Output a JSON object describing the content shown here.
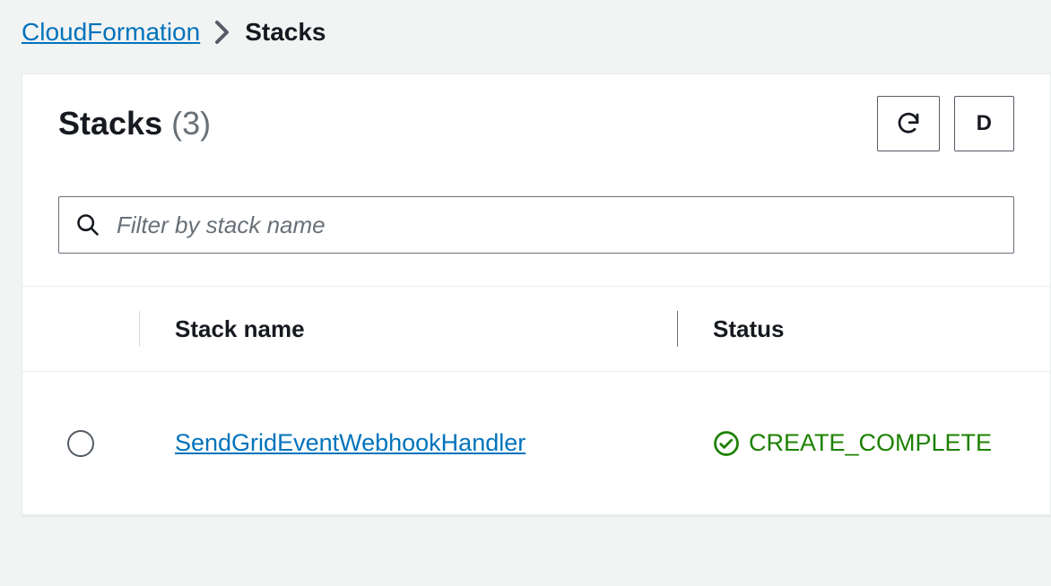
{
  "breadcrumb": {
    "root": "CloudFormation",
    "current": "Stacks"
  },
  "header": {
    "title": "Stacks",
    "count": "(3)",
    "delete_label": "D"
  },
  "filter": {
    "placeholder": "Filter by stack name"
  },
  "table": {
    "columns": {
      "name": "Stack name",
      "status": "Status"
    },
    "rows": [
      {
        "name": "SendGridEventWebhookHandler",
        "status": "CREATE_COMPLETE",
        "status_color": "#1d8102"
      }
    ]
  }
}
